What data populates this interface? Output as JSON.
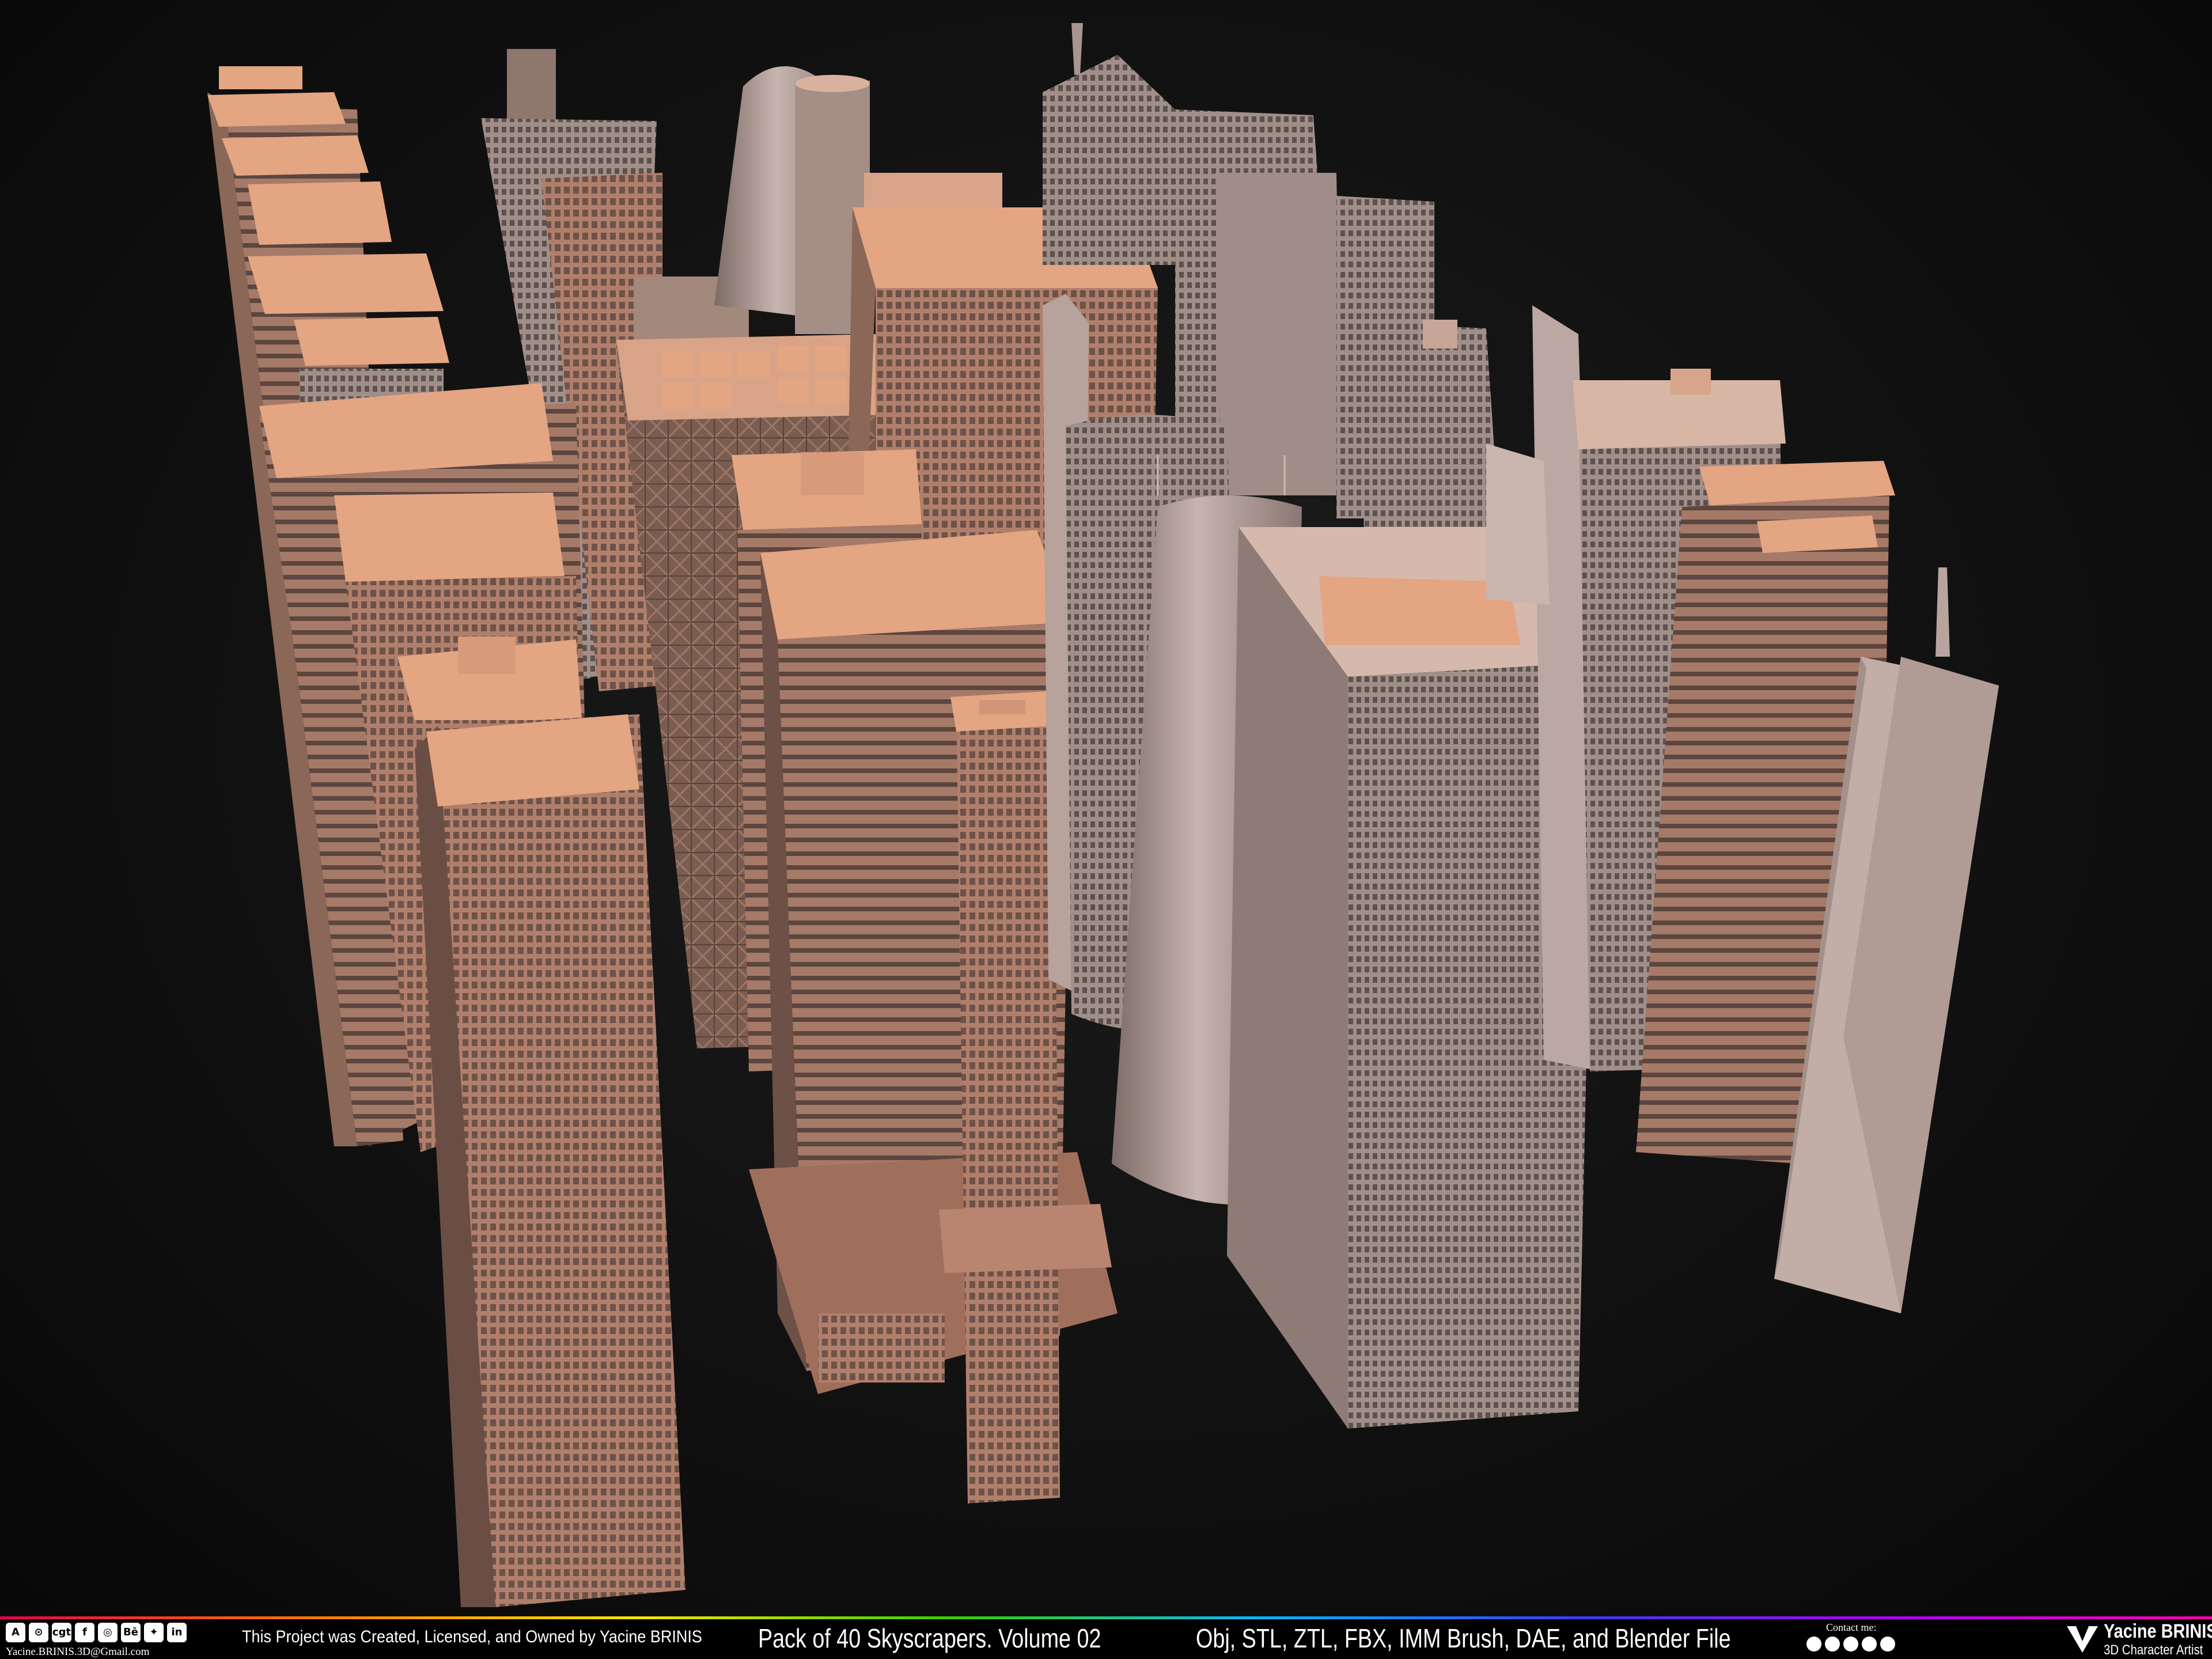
{
  "footer": {
    "social_icons": [
      "artstation-icon",
      "sketchfab-icon",
      "cgtrader-icon",
      "facebook-icon",
      "instagram-icon",
      "behance-icon",
      "turbosquid-icon",
      "linkedin-icon"
    ],
    "social_glyphs": [
      "A",
      "⊙",
      "cgt",
      "f",
      "◎",
      "Bē",
      "✦",
      "in"
    ],
    "email": "Yacine.BRINIS.3D@Gmail.com",
    "credit": "This Project was Created, Licensed, and Owned by Yacine BRINIS",
    "title": "Pack of 40 Skyscrapers. Volume 02",
    "formats": "Obj, STL, ZTL, FBX, IMM Brush, DAE, and Blender File",
    "contact_label": "Contact me:",
    "contact_icons": [
      "facebook-icon",
      "messenger-icon",
      "instagram-icon",
      "whatsapp-icon",
      "email-icon"
    ],
    "brand_name": "Yacine BRINIS",
    "brand_sub": "3D Character Artist"
  },
  "colors": {
    "background": "#0e0e0e",
    "roof": "#e4a583",
    "facade_warm": "#c48f78",
    "facade_grey": "#a99590",
    "facade_dark": "#6e5a52",
    "footer_bg": "#000000"
  }
}
